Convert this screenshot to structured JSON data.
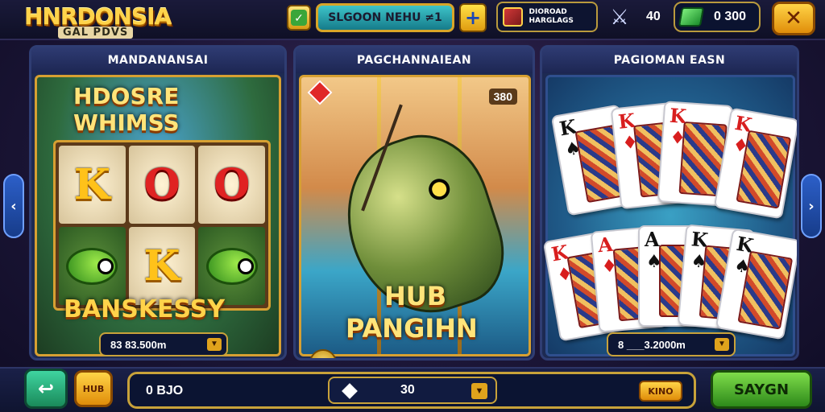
{
  "header": {
    "logo_line1": "HNRDONSIA",
    "logo_line2": "GAL PDVS",
    "check_icon": "check-icon",
    "banner_label": "SLGOON NEHU ≠1",
    "plus_icon": "plus-icon",
    "info_text": "DIOROAD HARGLAGS",
    "shield_icon": "shield-icon",
    "count": "40",
    "coin_balance": "0 300",
    "close_icon": "close-icon"
  },
  "panels": [
    {
      "title": "MANDANANSAI",
      "heading": "HDOSRE WHIMSS",
      "reels": [
        "K",
        "O",
        "O",
        "fish",
        "K",
        "fish"
      ],
      "footer": "BANSKESSY",
      "bet_value": "83   83.500m"
    },
    {
      "title": "PAGCHANNAIEAN",
      "score": "380",
      "line1": "HUB",
      "line2": "PANGIHN"
    },
    {
      "title": "PAGIOMAN EASN",
      "cards_top": [
        {
          "rank": "K",
          "suit": "♠",
          "color": "blk"
        },
        {
          "rank": "K",
          "suit": "♦",
          "color": "red"
        },
        {
          "rank": "K",
          "suit": "♦",
          "color": "red"
        },
        {
          "rank": "K",
          "suit": "♦",
          "color": "red"
        }
      ],
      "cards_bottom": [
        {
          "rank": "K",
          "suit": "♦",
          "color": "red"
        },
        {
          "rank": "A",
          "suit": "♦",
          "color": "red"
        },
        {
          "rank": "A",
          "suit": "♠",
          "color": "blk"
        },
        {
          "rank": "K",
          "suit": "♠",
          "color": "blk"
        },
        {
          "rank": "K",
          "suit": "♠",
          "color": "blk"
        }
      ],
      "bet_value": "8 ___3.2000m"
    }
  ],
  "footer": {
    "share_icon": "share-icon",
    "hub_label": "HUB",
    "total_label": "0 BJO",
    "bet_amount": "30",
    "tag_label": "KINO",
    "spin_label": "SAYGN"
  },
  "colors": {
    "accent_gold": "#d7a032",
    "spin_green": "#2d8a1a"
  }
}
